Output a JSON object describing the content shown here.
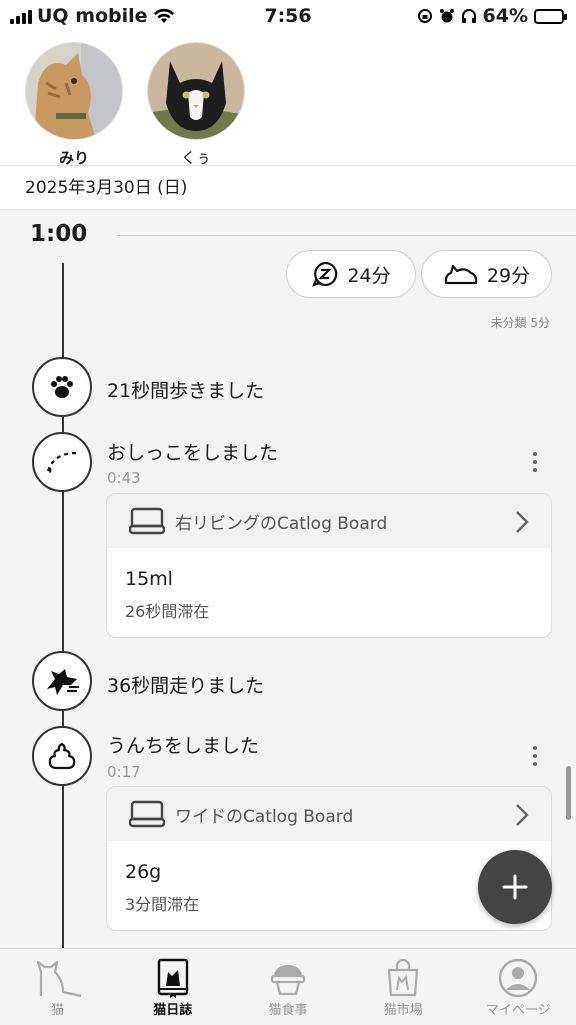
{
  "status_bar": {
    "carrier": "UQ mobile",
    "time": "7:56",
    "battery": "64%",
    "battery_level": 0.64
  },
  "cats": [
    {
      "name": "みり",
      "active": true
    },
    {
      "name": "くぅ",
      "active": false
    }
  ],
  "date": "2025年3月30日 (日)",
  "timeline": {
    "hour": "1:00",
    "summary": {
      "sleep": "24分",
      "rest": "29分",
      "uncategorized": "未分類 5分"
    },
    "events": [
      {
        "title": "21秒間歩きました",
        "icon": "paw-icon"
      },
      {
        "title": "おしっこをしました",
        "time": "0:43",
        "icon": "pee-icon",
        "card": {
          "device": "右リビングのCatlog Board",
          "amount": "15ml",
          "duration": "26秒間滞在"
        }
      },
      {
        "title": "36秒間走りました",
        "icon": "running-cat-icon"
      },
      {
        "title": "うんちをしました",
        "time": "0:17",
        "icon": "poop-icon",
        "card": {
          "device": "ワイドのCatlog Board",
          "amount": "26g",
          "duration": "3分間滞在"
        }
      }
    ]
  },
  "tabs": [
    {
      "label": "猫",
      "icon": "cat-icon",
      "active": false
    },
    {
      "label": "猫日誌",
      "icon": "diary-icon",
      "active": true
    },
    {
      "label": "猫食事",
      "icon": "food-bowl-icon",
      "active": false
    },
    {
      "label": "猫市場",
      "icon": "shopping-bag-icon",
      "active": false
    },
    {
      "label": "マイページ",
      "icon": "profile-icon",
      "active": false
    }
  ],
  "colors": {
    "accent": "#111111",
    "fab": "#444444",
    "background": "#f4f4f4"
  }
}
